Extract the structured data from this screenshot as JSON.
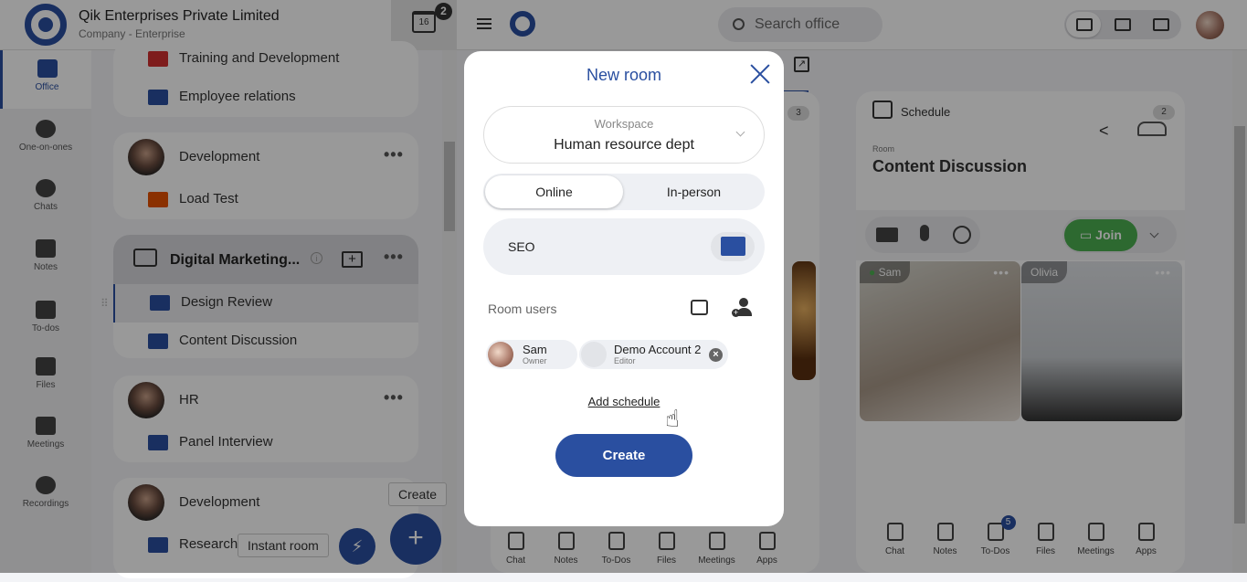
{
  "header": {
    "company_name": "Qik Enterprises Private Limited",
    "company_type": "Company - Enterprise",
    "calendar_day": "16",
    "calendar_badge": "2",
    "search_placeholder": "Search office"
  },
  "sidenav": {
    "items": [
      {
        "label": "Office",
        "icon": "briefcase-icon",
        "active": true
      },
      {
        "label": "One-on-ones",
        "icon": "people-icon"
      },
      {
        "label": "Chats",
        "icon": "chat-bubbles-icon"
      },
      {
        "label": "Notes",
        "icon": "notes-icon"
      },
      {
        "label": "To-dos",
        "icon": "checkbox-icon"
      },
      {
        "label": "Files",
        "icon": "files-icon"
      },
      {
        "label": "Meetings",
        "icon": "meetings-icon"
      },
      {
        "label": "Recordings",
        "icon": "recordings-icon"
      }
    ]
  },
  "workspaces": {
    "top_card": {
      "rooms": [
        {
          "name": "Training and Development",
          "color": "#d32f2f"
        },
        {
          "name": "Employee relations",
          "color": "#2a4fa0"
        }
      ]
    },
    "dev_card": {
      "title": "Development",
      "rooms": [
        {
          "name": "Load Test",
          "color": "#e65100"
        }
      ]
    },
    "dm_card": {
      "title": "Digital Marketing...",
      "rooms": [
        {
          "name": "Design Review",
          "color": "#2a4fa0",
          "selected": true
        },
        {
          "name": "Content Discussion",
          "color": "#2a4fa0"
        }
      ]
    },
    "hr_card": {
      "title": "HR",
      "rooms": [
        {
          "name": "Panel Interview",
          "color": "#2a4fa0"
        }
      ]
    },
    "dev2_card": {
      "title": "Development",
      "rooms": [
        {
          "name": "Research",
          "color": "#2a4fa0"
        }
      ]
    }
  },
  "fab": {
    "create_tooltip": "Create",
    "instant_tooltip": "Instant room"
  },
  "middle_card": {
    "participants_count": "3",
    "bottom": [
      "Chat",
      "Notes",
      "To-Dos",
      "Files",
      "Meetings",
      "Apps"
    ]
  },
  "right_card": {
    "schedule_label": "Schedule",
    "participants_count": "2",
    "room_label": "Room",
    "room_title": "Content Discussion",
    "join_label": "Join",
    "tiles": [
      {
        "name": "Sam",
        "online": true
      },
      {
        "name": "Olivia"
      }
    ],
    "bottom": [
      "Chat",
      "Notes",
      "To-Dos",
      "Files",
      "Meetings",
      "Apps"
    ],
    "todo_badge": "5"
  },
  "modal": {
    "title": "New room",
    "workspace_label": "Workspace",
    "workspace_value": "Human resource dept",
    "type_options": [
      "Online",
      "In-person"
    ],
    "type_selected": "Online",
    "room_name": "SEO",
    "room_color": "#2a4fa0",
    "room_users_label": "Room users",
    "users": [
      {
        "name": "Sam",
        "role": "Owner"
      },
      {
        "name": "Demo Account 2",
        "role": "Editor"
      }
    ],
    "add_schedule": "Add schedule",
    "create_label": "Create"
  },
  "colors": {
    "brand": "#2a4fa0",
    "join": "#4caf50"
  }
}
